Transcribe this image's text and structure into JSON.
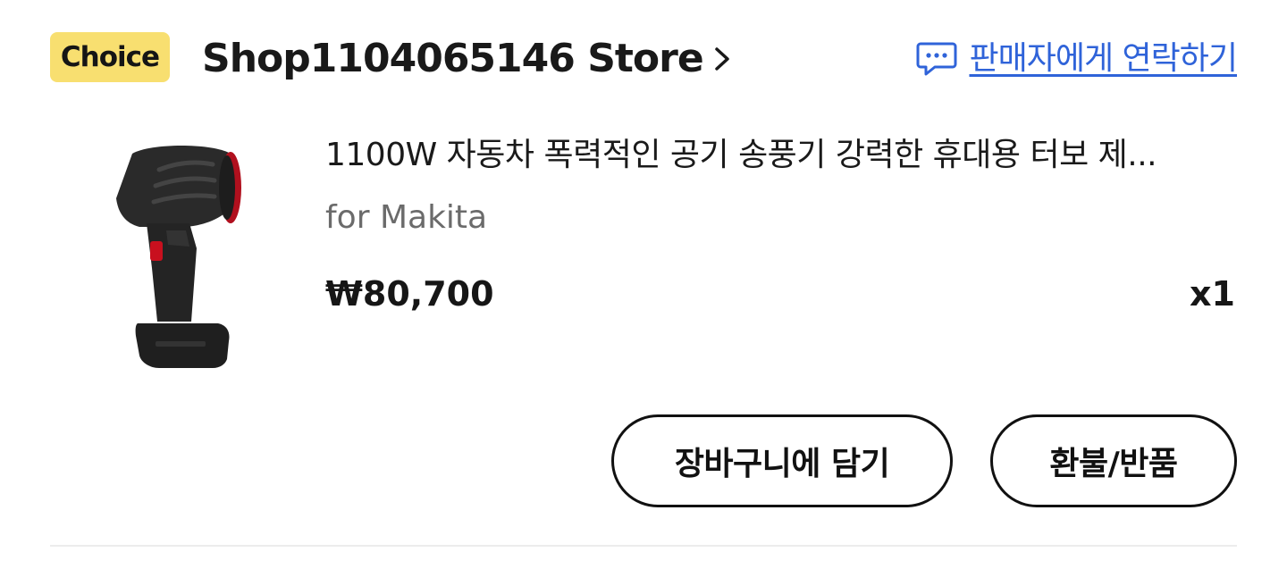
{
  "header": {
    "badge": "Choice",
    "store_name": "Shop1104065146 Store",
    "contact_label": "판매자에게 연락하기"
  },
  "product": {
    "title": "1100W 자동차 폭력적인 공기 송풍기 강력한 휴대용 터보 제...",
    "variant": "for Makita",
    "price": "₩80,700",
    "quantity": "x1"
  },
  "actions": {
    "add_to_cart": "장바구니에 담기",
    "refund_return": "환불/반품"
  },
  "colors": {
    "badge_bg": "#f8df70",
    "link_blue": "#2f63d9"
  },
  "icons": {
    "contact": "chat-bubble-icon",
    "store": "chevron-right-icon"
  }
}
